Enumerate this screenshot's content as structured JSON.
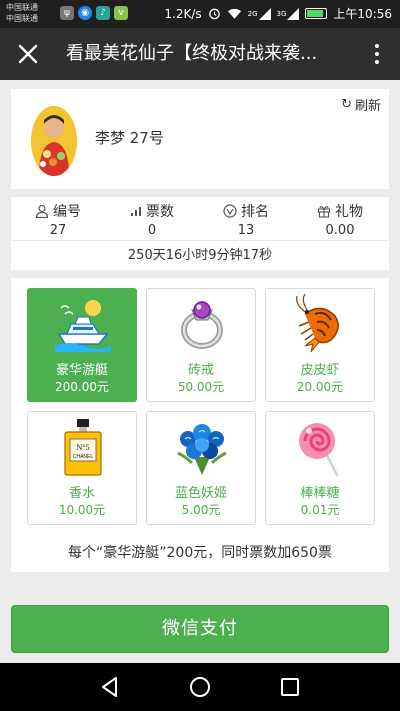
{
  "statusbar": {
    "carrier1": "中国联通",
    "carrier2": "中国联通",
    "speed": "1.2K/s",
    "network1": "2G",
    "network2": "3G",
    "time": "上午10:56",
    "battery_level": 0.85
  },
  "titlebar": {
    "title": "看最美花仙子【终极对战来袭..."
  },
  "profile": {
    "refresh_label": "刷新",
    "name": "李梦 27号"
  },
  "stats": {
    "items": [
      {
        "label": "编号",
        "value": "27"
      },
      {
        "label": "票数",
        "value": "0"
      },
      {
        "label": "排名",
        "value": "13"
      },
      {
        "label": "礼物",
        "value": "0.00"
      }
    ],
    "countdown": "250天16小时9分钟17秒"
  },
  "gifts": {
    "items": [
      {
        "name": "豪华游艇",
        "price": "200.00元",
        "icon": "yacht-icon",
        "selected": true
      },
      {
        "name": "砖戒",
        "price": "50.00元",
        "icon": "ring-icon",
        "selected": false
      },
      {
        "name": "皮皮虾",
        "price": "20.00元",
        "icon": "shrimp-icon",
        "selected": false
      },
      {
        "name": "香水",
        "price": "10.00元",
        "icon": "perfume-icon",
        "selected": false
      },
      {
        "name": "蓝色妖姬",
        "price": "5.00元",
        "icon": "blue-rose-icon",
        "selected": false
      },
      {
        "name": "棒棒糖",
        "price": "0.01元",
        "icon": "lollipop-icon",
        "selected": false
      }
    ],
    "perfume_label_top": "N°5",
    "perfume_label_bottom": "CHANEL",
    "note": "每个“豪华游艇”200元，同时票数加650票"
  },
  "pay": {
    "label": "微信支付"
  },
  "colors": {
    "accent": "#4cb050",
    "titlebar": "#2f2f2f"
  }
}
